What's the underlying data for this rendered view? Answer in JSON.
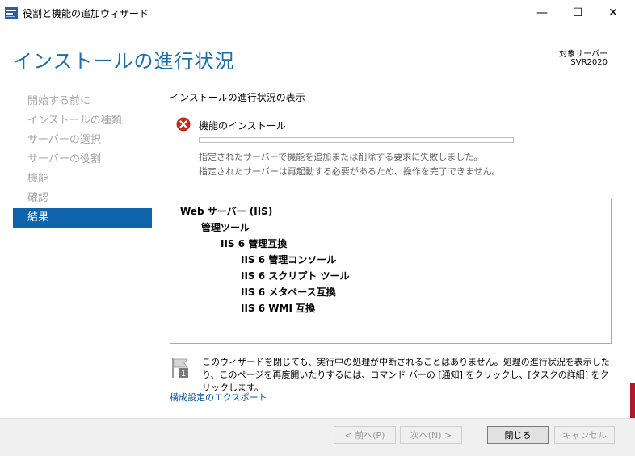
{
  "window": {
    "title": "役割と機能の追加ウィザード",
    "minimize_glyph": "—",
    "maximize_glyph": "☐",
    "close_glyph": "✕"
  },
  "header": {
    "title": "インストールの進行状況",
    "target_label": "対象サーバー",
    "target_value": "SVR2020"
  },
  "nav": {
    "items": [
      {
        "label": "開始する前に"
      },
      {
        "label": "インストールの種類"
      },
      {
        "label": "サーバーの選択"
      },
      {
        "label": "サーバーの役割"
      },
      {
        "label": "機能"
      },
      {
        "label": "確認"
      },
      {
        "label": "結果"
      }
    ],
    "active_index": 6
  },
  "main": {
    "section_title": "インストールの進行状況の表示",
    "feature_title": "機能のインストール",
    "progress_percent": 0,
    "status_lines": [
      "指定されたサーバーで機能を追加または削除する要求に失敗しました。",
      "指定されたサーバーは再起動する必要があるため、操作を完了できません。"
    ],
    "results": [
      {
        "text": "Web サーバー (IIS)",
        "level": 0
      },
      {
        "text": "管理ツール",
        "level": 1
      },
      {
        "text": "IIS 6 管理互換",
        "level": 2
      },
      {
        "text": "IIS 6 管理コンソール",
        "level": 3
      },
      {
        "text": "IIS 6 スクリプト ツール",
        "level": 3
      },
      {
        "text": "IIS 6 メタベース互換",
        "level": 3
      },
      {
        "text": "IIS 6 WMI 互換",
        "level": 3
      }
    ],
    "note": "このウィザードを閉じても、実行中の処理が中断されることはありません。処理の進行状況を表示したり、このページを再度開いたりするには、コマンド バーの [通知] をクリックし、[タスクの詳細] をクリックします。",
    "note_icon_number": "1",
    "export_link": "構成設定のエクスポート"
  },
  "footer": {
    "prev_label": "< 前へ(P)",
    "next_label": "次へ(N) >",
    "close_label": "閉じる",
    "cancel_label": "キャンセル"
  },
  "colors": {
    "accent": "#0f63a8",
    "title_blue": "#1d6fa5",
    "error_red": "#c42b1c"
  }
}
